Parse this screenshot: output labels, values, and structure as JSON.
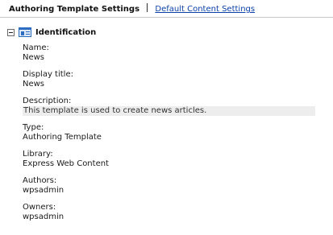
{
  "tabs": {
    "active": "Authoring Template Settings",
    "link": "Default Content Settings"
  },
  "section": {
    "title": "Identification",
    "icon": "identification-card-icon",
    "toggle_icon": "collapse-minus-icon"
  },
  "fields": {
    "name": {
      "label": "Name:",
      "value": "News"
    },
    "display_title": {
      "label": "Display title:",
      "value": "News"
    },
    "description": {
      "label": "Description:",
      "value": "This template is used to create news articles."
    },
    "type": {
      "label": "Type:",
      "value": "Authoring Template"
    },
    "library": {
      "label": "Library:",
      "value": "Express Web Content"
    },
    "authors": {
      "label": "Authors:",
      "value": "wpsadmin"
    },
    "owners": {
      "label": "Owners:",
      "value": "wpsadmin"
    }
  }
}
